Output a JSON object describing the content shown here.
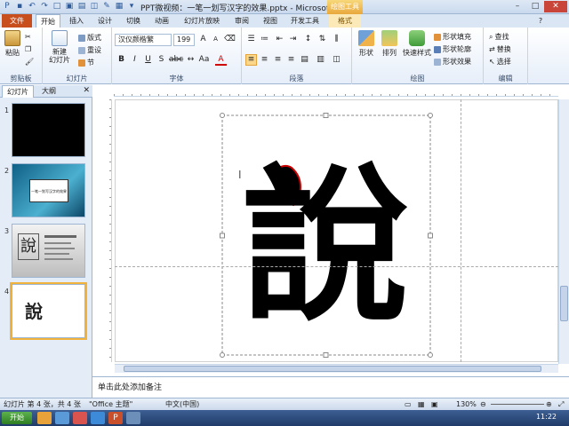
{
  "window": {
    "title": "PPT微视频：一笔一划写汉字的效果.pptx - Microsoft ...",
    "context_tab": "绘图工具"
  },
  "tabs": [
    "文件",
    "开始",
    "插入",
    "设计",
    "切换",
    "动画",
    "幻灯片放映",
    "审阅",
    "视图",
    "开发工具",
    "格式"
  ],
  "ribbon": {
    "clipboard": {
      "label": "剪贴板",
      "paste": "粘贴"
    },
    "slides": {
      "label": "幻灯片",
      "new_slide": "新建\n幻灯片",
      "layout": "版式",
      "reset": "重设",
      "section": "节"
    },
    "font": {
      "label": "字体",
      "font_name": "汉仪颜楷繁",
      "font_size": "199"
    },
    "paragraph": {
      "label": "段落"
    },
    "drawing": {
      "label": "绘图",
      "shape": "形状",
      "arrange": "排列",
      "quick_styles": "快速样式",
      "fill": "形状填充",
      "outline": "形状轮廓",
      "effects": "形状效果"
    },
    "editing": {
      "label": "编辑",
      "find": "查找",
      "replace": "替换",
      "select": "选择"
    }
  },
  "slide_pane": {
    "tabs": [
      "幻灯片",
      "大纲"
    ],
    "thumb_numbers": [
      "1",
      "2",
      "3",
      "4"
    ],
    "thumb2_text": "一笔一划写汉字的效果",
    "thumb4_char": "說"
  },
  "slide": {
    "character": "說"
  },
  "notes": {
    "placeholder": "单击此处添加备注"
  },
  "status": {
    "slide_info": "幻灯片 第 4 张，共 4 张",
    "theme": "\"Office 主题\"",
    "language": "中文(中国)",
    "zoom": "130%"
  },
  "taskbar": {
    "start": "开始",
    "clock": "11:22"
  },
  "colors": {
    "file_tab": "#c94e1e",
    "accent": "#2d5a9a",
    "highlight": "#fbd889"
  }
}
